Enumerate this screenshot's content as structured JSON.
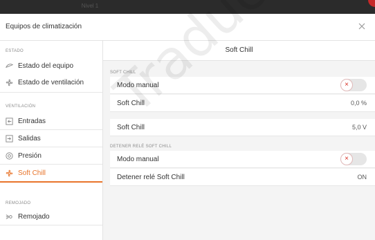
{
  "topbar": {
    "title": "Nivel 1"
  },
  "dialog": {
    "title": "Equipos de climatización"
  },
  "sidebar": {
    "sections": [
      {
        "label": "ESTADO"
      },
      {
        "label": "VENTILACIÓN"
      },
      {
        "label": "REMOJADO"
      }
    ],
    "items": [
      {
        "label": "Estado del equipo",
        "icon": "fan-blade-icon"
      },
      {
        "label": "Estado de ventilación",
        "icon": "ventilation-icon"
      },
      {
        "label": "Entradas",
        "icon": "inlet-icon"
      },
      {
        "label": "Salidas",
        "icon": "outlet-icon"
      },
      {
        "label": "Presión",
        "icon": "pressure-icon"
      },
      {
        "label": "Soft Chill",
        "icon": "soft-chill-icon",
        "active": true
      },
      {
        "label": "Remojado",
        "icon": "soaking-icon"
      }
    ]
  },
  "main": {
    "title": "Soft Chill",
    "groups": [
      {
        "label": "SOFT CHILL",
        "rows": [
          {
            "label": "Modo manual",
            "type": "toggle",
            "state": "off"
          },
          {
            "label": "Soft Chill",
            "value": "0,0 %"
          }
        ]
      },
      {
        "label": "",
        "rows": [
          {
            "label": "Soft Chill",
            "value": "5,0 V"
          }
        ]
      },
      {
        "label": "DETENER RELÉ SOFT CHILL",
        "rows": [
          {
            "label": "Modo manual",
            "type": "toggle",
            "state": "off"
          },
          {
            "label": "Detener relé Soft Chill",
            "value": "ON"
          }
        ]
      }
    ]
  },
  "watermark": {
    "text": "Traducir"
  },
  "colors": {
    "accent": "#e8742a",
    "toggle_off_x": "#d93025",
    "topbar": "#2b2b2b"
  }
}
